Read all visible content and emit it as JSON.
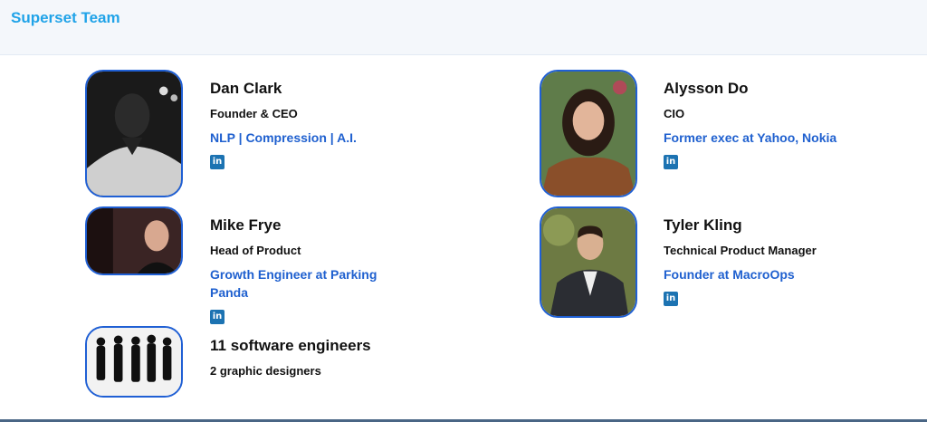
{
  "header": {
    "title": "Superset Team"
  },
  "members": [
    {
      "name": "Dan Clark",
      "role": "Founder & CEO",
      "desc": "NLP | Compression | A.I.",
      "linkedin": "in"
    },
    {
      "name": "Alysson Do",
      "role": "CIO",
      "desc": "Former exec at Yahoo, Nokia",
      "linkedin": "in"
    },
    {
      "name": "Mike Frye",
      "role": "Head of Product",
      "desc": "Growth Engineer at Parking Panda",
      "linkedin": "in"
    },
    {
      "name": "Tyler Kling",
      "role": "Technical Product Manager",
      "desc": "Founder at MacroOps",
      "linkedin": "in"
    },
    {
      "name": "11 software engineers",
      "role": "2 graphic designers"
    }
  ],
  "colors": {
    "accent": "#20a3e8",
    "link": "#1f60cf",
    "border": "#1f5fd4",
    "linkedin": "#1c73b2"
  },
  "icons": {
    "linkedin": "linkedin-icon"
  }
}
